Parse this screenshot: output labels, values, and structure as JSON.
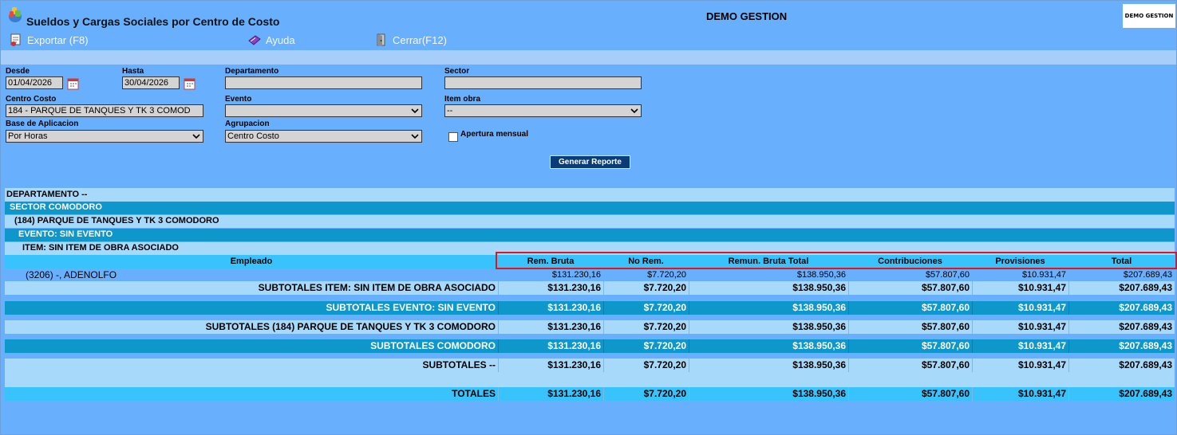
{
  "window": {
    "title": "Sueldos y Cargas Sociales por Centro de Costo",
    "brand": "DEMO GESTION",
    "logo_text": "DEMO GESTION"
  },
  "toolbar": {
    "export_label": "Exportar (F8)",
    "help_label": "Ayuda",
    "close_label": "Cerrar(F12)",
    "export_icon": "export-icon",
    "help_icon": "help-book-icon",
    "close_icon": "close-door-icon"
  },
  "form": {
    "desde_label": "Desde",
    "desde_value": "01/04/2026",
    "hasta_label": "Hasta",
    "hasta_value": "30/04/2026",
    "departamento_label": "Departamento",
    "departamento_value": "",
    "sector_label": "Sector",
    "sector_value": "",
    "centro_costo_label": "Centro Costo",
    "centro_costo_value": "184 - PARQUE DE TANQUES Y TK 3 COMOD",
    "evento_label": "Evento",
    "evento_value": "",
    "item_obra_label": "Item obra",
    "item_obra_value": "--",
    "base_label": "Base de Aplicacion",
    "base_value": "Por Horas",
    "agrupacion_label": "Agrupacion",
    "agrupacion_value": "Centro Costo",
    "apertura_label": "Apertura mensual",
    "apertura_checked": false,
    "generate_label": "Generar Reporte"
  },
  "report": {
    "departamento": "DEPARTAMENTO --",
    "sector": "SECTOR COMODORO",
    "centro": "(184) PARQUE DE TANQUES Y TK 3 COMODORO",
    "evento": "EVENTO: SIN EVENTO",
    "item": "ITEM: SIN ITEM DE OBRA ASOCIADO",
    "columns": [
      "Empleado",
      "Rem. Bruta",
      "No Rem.",
      "Remun. Bruta Total",
      "Contribuciones",
      "Provisiones",
      "Total"
    ],
    "employee": {
      "name": "(3206) -, ADENOLFO",
      "values": [
        "$131.230,16",
        "$7.720,20",
        "$138.950,36",
        "$57.807,60",
        "$10.931,47",
        "$207.689,43"
      ]
    },
    "subtotals": [
      {
        "label": "SUBTOTALES ITEM: SIN ITEM DE OBRA ASOCIADO",
        "values": [
          "$131.230,16",
          "$7.720,20",
          "$138.950,36",
          "$57.807,60",
          "$10.931,47",
          "$207.689,43"
        ]
      },
      {
        "label": "SUBTOTALES EVENTO: SIN EVENTO",
        "values": [
          "$131.230,16",
          "$7.720,20",
          "$138.950,36",
          "$57.807,60",
          "$10.931,47",
          "$207.689,43"
        ]
      },
      {
        "label": "SUBTOTALES (184) PARQUE DE TANQUES Y TK 3 COMODORO",
        "values": [
          "$131.230,16",
          "$7.720,20",
          "$138.950,36",
          "$57.807,60",
          "$10.931,47",
          "$207.689,43"
        ]
      },
      {
        "label": "SUBTOTALES COMODORO",
        "values": [
          "$131.230,16",
          "$7.720,20",
          "$138.950,36",
          "$57.807,60",
          "$10.931,47",
          "$207.689,43"
        ]
      },
      {
        "label": "SUBTOTALES --",
        "values": [
          "$131.230,16",
          "$7.720,20",
          "$138.950,36",
          "$57.807,60",
          "$10.931,47",
          "$207.689,43"
        ]
      }
    ],
    "totals": {
      "label": "TOTALES",
      "values": [
        "$131.230,16",
        "$7.720,20",
        "$138.950,36",
        "$57.807,60",
        "$10.931,47",
        "$207.689,43"
      ]
    }
  },
  "colors": {
    "background": "#68b0fd",
    "light_row": "#a7d9fb",
    "dark_row": "#0d97cb",
    "header_row": "#38c3fd",
    "highlight": "#e3151b"
  }
}
